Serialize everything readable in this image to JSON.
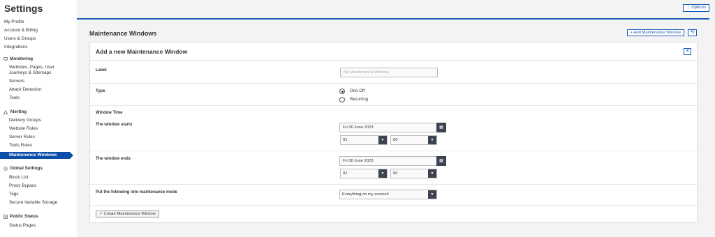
{
  "app": {
    "title": "Settings"
  },
  "sidebar": {
    "top_items": [
      {
        "label": "My Profile"
      },
      {
        "label": "Account & Billing"
      },
      {
        "label": "Users & Groups"
      },
      {
        "label": "Integrations"
      }
    ],
    "monitoring": {
      "heading": "Monitoring",
      "icon": "monitor-icon",
      "items": [
        {
          "label": "Websites, Pages, User Journeys & Sitemaps"
        },
        {
          "label": "Servers"
        },
        {
          "label": "Attack Detection"
        },
        {
          "label": "Tools"
        }
      ]
    },
    "alerting": {
      "heading": "Alerting",
      "icon": "warning-icon",
      "items": [
        {
          "label": "Delivery Groups"
        },
        {
          "label": "Website Rules"
        },
        {
          "label": "Server Rules"
        },
        {
          "label": "Tools Rules"
        },
        {
          "label": "Maintenance Windows"
        }
      ]
    },
    "global": {
      "heading": "Global Settings",
      "icon": "gear-icon",
      "items": [
        {
          "label": "Block List"
        },
        {
          "label": "Proxy Bypass"
        },
        {
          "label": "Tags"
        },
        {
          "label": "Secure Variable Storage"
        }
      ]
    },
    "public_status": {
      "heading": "Public Status",
      "icon": "status-page-icon",
      "items": [
        {
          "label": "Status Pages"
        }
      ]
    }
  },
  "header": {
    "options_label": "⋮ Options",
    "page_title": "Maintenance Windows",
    "add_label": "+ Add Maintenance Window",
    "undo_icon": "undo-icon"
  },
  "form": {
    "title": "Add a new Maintenance Window",
    "close_icon": "close-icon",
    "label_field": {
      "label": "Label",
      "placeholder": "My Maintenance Window"
    },
    "type_field": {
      "label": "Type",
      "options": [
        {
          "label": "One-Off",
          "selected": true
        },
        {
          "label": "Recurring",
          "selected": false
        }
      ]
    },
    "window_time_heading": "Window Time",
    "starts": {
      "label": "The window starts",
      "date": "Fri 30 June 2023",
      "hour": "01",
      "minute": "00"
    },
    "ends": {
      "label": "The window ends",
      "date": "Fri 30 June 2023",
      "hour": "02",
      "minute": "00"
    },
    "scope": {
      "label": "Put the following into maintenance mode",
      "value": "Everything on my account"
    },
    "submit_label": "✓ Create Maintenance Window"
  },
  "colors": {
    "accent": "#1a5bb5",
    "active_nav": "#0c4fa8",
    "dark_control": "#3d4350"
  }
}
